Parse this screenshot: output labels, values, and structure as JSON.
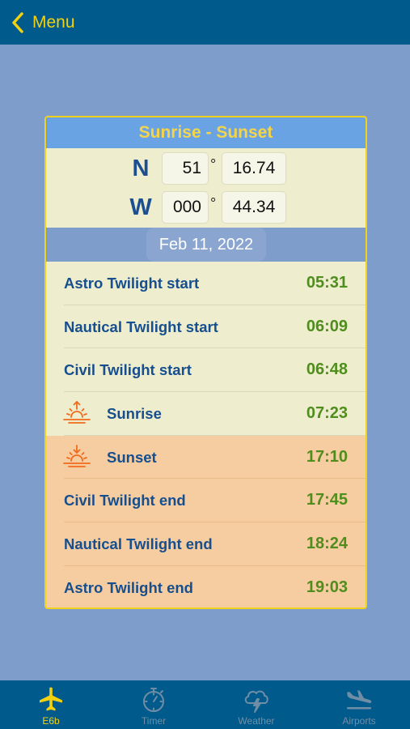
{
  "navbar": {
    "back_label": "Menu",
    "back_icon": "chevron-left-icon"
  },
  "card": {
    "title": "Sunrise - Sunset",
    "latitude": {
      "hemisphere": "N",
      "degrees": "51",
      "degree_symbol": "°",
      "minutes": "16.74"
    },
    "longitude": {
      "hemisphere": "W",
      "degrees": "000",
      "degree_symbol": "°",
      "minutes": "44.34"
    },
    "date": "Feb 11, 2022",
    "events": [
      {
        "label": "Astro Twilight start",
        "time": "05:31"
      },
      {
        "label": "Nautical Twilight start",
        "time": "06:09"
      },
      {
        "label": "Civil Twilight start",
        "time": "06:48"
      },
      {
        "label": "Sunrise",
        "time": "07:23",
        "icon": "sunrise-icon"
      },
      {
        "label": "Sunset",
        "time": "17:10",
        "icon": "sunset-icon"
      },
      {
        "label": "Civil Twilight end",
        "time": "17:45"
      },
      {
        "label": "Nautical Twilight end",
        "time": "18:24"
      },
      {
        "label": "Astro Twilight end",
        "time": "19:03"
      }
    ]
  },
  "tabs": [
    {
      "label": "E6b",
      "icon": "airplane-icon",
      "active": true
    },
    {
      "label": "Timer",
      "icon": "stopwatch-icon",
      "active": false
    },
    {
      "label": "Weather",
      "icon": "storm-cloud-icon",
      "active": false
    },
    {
      "label": "Airports",
      "icon": "landing-icon",
      "active": false
    }
  ],
  "colors": {
    "navbar": "#015a8c",
    "accent_yellow": "#f3d10e",
    "background": "#7f9dcb",
    "label_blue": "#174e8e",
    "time_green": "#4f8d1c",
    "day_row": "#eeeecf",
    "night_row": "#f5cda0",
    "sun_icon_orange": "#f26b1d"
  }
}
